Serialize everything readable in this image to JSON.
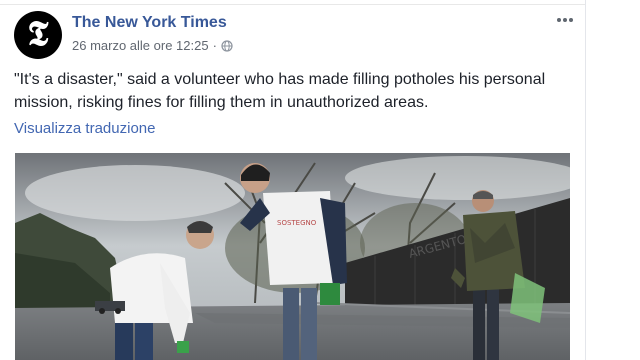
{
  "post": {
    "author": "The New York Times",
    "avatar_label": "NYT logo",
    "timestamp": "26 marzo alle ore 12:25",
    "separator": "·",
    "privacy_icon": "globe-icon",
    "more_icon": "more-options-icon",
    "text": "\"It's a disaster,\" said a volunteer who has made filling potholes his personal mission, risking fines for filling them in unauthorized areas.",
    "translate_link": "Visualizza traduzione",
    "photo_icon": "news-photo"
  },
  "colors": {
    "author": "#385898",
    "link": "#4267b2",
    "text": "#1d2129",
    "meta": "#616770"
  }
}
